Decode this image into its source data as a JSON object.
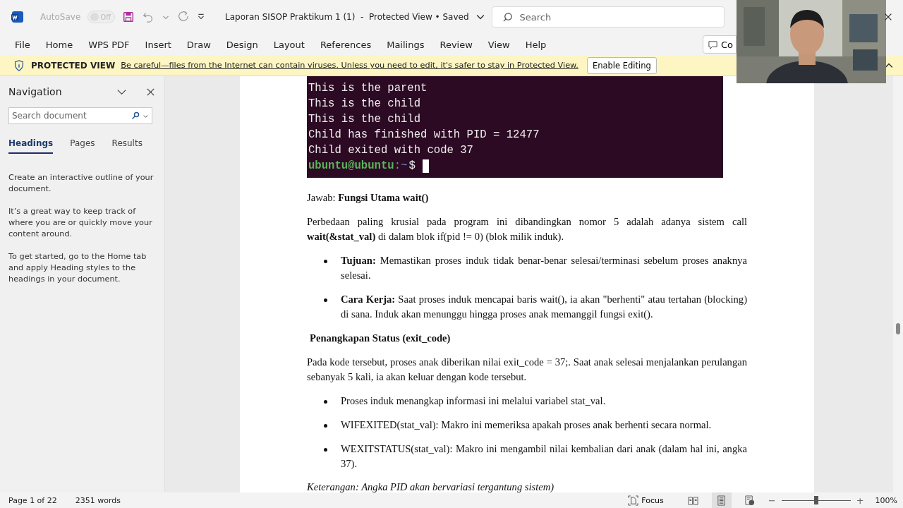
{
  "title_bar": {
    "autosave": {
      "label": "AutoSave",
      "on": false,
      "state_text": "Off"
    },
    "title": "Laporan SISOP Praktikum 1 (1)  -  Protected View • Saved",
    "search": {
      "placeholder": "Search"
    }
  },
  "menu": [
    {
      "label": "File"
    },
    {
      "label": "Home"
    },
    {
      "label": "WPS PDF"
    },
    {
      "label": "Insert"
    },
    {
      "label": "Draw"
    },
    {
      "label": "Design"
    },
    {
      "label": "Layout"
    },
    {
      "label": "References"
    },
    {
      "label": "Mailings"
    },
    {
      "label": "Review"
    },
    {
      "label": "View"
    },
    {
      "label": "Help"
    }
  ],
  "comments_button": {
    "label": "Co"
  },
  "protected_bar": {
    "label": "PROTECTED VIEW",
    "message": "Be careful—files from the Internet can contain viruses. Unless you need to edit, it's safer to stay in Protected View.",
    "button": "Enable Editing"
  },
  "navigation": {
    "title": "Navigation",
    "search": {
      "placeholder": "Search document"
    },
    "tabs": [
      {
        "label": "Headings",
        "selected": true
      },
      {
        "label": "Pages",
        "selected": false
      },
      {
        "label": "Results",
        "selected": false
      }
    ],
    "paragraphs": [
      "Create an interactive outline of your document.",
      "It’s a great way to keep track of where you are or quickly move your content around.",
      "To get started, go to the Home tab and apply Heading styles to the headings in your document."
    ]
  },
  "document": {
    "terminal": {
      "lines": [
        "This is the parent",
        "This is the child",
        "This is the child",
        "Child has finished with PID = 12477",
        "Child exited with code 37"
      ],
      "prompt": {
        "user": "ubuntu@ubuntu",
        "path": ":~",
        "symbol": "$"
      }
    },
    "blocks": [
      {
        "kind": "paragraph",
        "text": "Jawab: **Fungsi Utama wait()**"
      },
      {
        "kind": "paragraph",
        "text": "Perbedaan paling krusial pada program ini dibandingkan nomor 5 adalah adanya sistem call **wait(&stat_val)** di dalam blok if(pid != 0) (blok milik induk)."
      },
      {
        "kind": "bullet",
        "text": "**Tujuan:** Memastikan proses induk tidak benar-benar selesai/terminasi sebelum proses anaknya selesai."
      },
      {
        "kind": "bullet",
        "text": "**Cara Kerja:** Saat proses induk mencapai baris wait(), ia akan \"berhenti\" atau tertahan (blocking) di sana. Induk akan menunggu hingga proses anak memanggil fungsi exit()."
      },
      {
        "kind": "heading",
        "text": "Penangkapan Status (exit_code)"
      },
      {
        "kind": "paragraph",
        "text": "Pada kode tersebut, proses anak diberikan nilai exit_code = 37;. Saat anak selesai menjalankan perulangan sebanyak 5 kali, ia akan keluar dengan kode tersebut."
      },
      {
        "kind": "bullet",
        "text": "Proses induk menangkap informasi ini melalui variabel stat_val."
      },
      {
        "kind": "bullet",
        "text": "WIFEXITED(stat_val): Makro ini memeriksa apakah proses anak berhenti secara normal."
      },
      {
        "kind": "bullet",
        "text": "WEXITSTATUS(stat_val): Makro ini mengambil nilai kembalian dari anak (dalam hal ini, angka 37)."
      },
      {
        "kind": "note",
        "text": "Keterangan: Angka PID akan bervariasi tergantung sistem)"
      }
    ]
  },
  "status_bar": {
    "page": "Page 1 of 22",
    "words": "2351 words",
    "focus": "Focus",
    "views": [
      {
        "kind": "read",
        "selected": false
      },
      {
        "kind": "print",
        "selected": true
      },
      {
        "kind": "web",
        "selected": false
      }
    ],
    "zoom": {
      "minus": "−",
      "level": 0.5,
      "plus": "+",
      "reading": "100%"
    }
  }
}
